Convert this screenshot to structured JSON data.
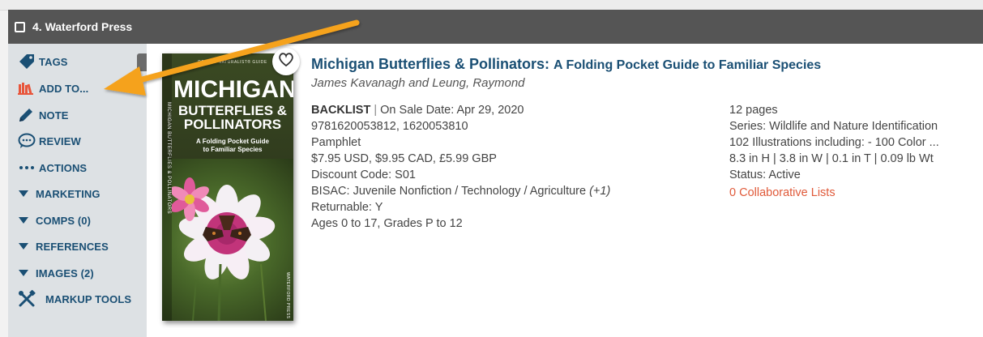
{
  "header": {
    "title": "4. Waterford Press"
  },
  "sidebar": {
    "items": [
      {
        "label": "TAGS",
        "icon": "tag-icon"
      },
      {
        "label": "ADD TO...",
        "icon": "books-icon"
      },
      {
        "label": "NOTE",
        "icon": "pencil-icon"
      },
      {
        "label": "REVIEW",
        "icon": "speech-bubble-icon"
      },
      {
        "label": "ACTIONS",
        "icon": "dots-icon"
      },
      {
        "label": "MARKETING",
        "icon": "caret-down-icon"
      },
      {
        "label": "COMPS (0)",
        "icon": "caret-down-icon"
      },
      {
        "label": "REFERENCES",
        "icon": "caret-down-icon"
      },
      {
        "label": "IMAGES (2)",
        "icon": "caret-down-icon"
      },
      {
        "label": "MARKUP TOOLS",
        "icon": "tools-icon"
      }
    ]
  },
  "cover": {
    "series": "POCKET NATURALIST® GUIDE",
    "title_line1": "MICHIGAN",
    "title_line2": "BUTTERFLIES &",
    "title_line3": "POLLINATORS",
    "subtitle_line1": "A Folding Pocket Guide",
    "subtitle_line2": "to Familiar Species",
    "side_title": "MICHIGAN BUTTERFLIES & POLLINATORS",
    "side_subtitle": "to Familiar Species",
    "publisher": "WATERFORD PRESS"
  },
  "book": {
    "title": "Michigan Butterflies & Pollinators:",
    "subtitle": "A Folding Pocket Guide to Familiar Species",
    "authors": "James Kavanagh and Leung, Raymond",
    "status_label": "BACKLIST",
    "separator": "|",
    "on_sale": "On Sale Date: Apr 29, 2020",
    "isbns": "9781620053812, 1620053810",
    "format": "Pamphlet",
    "prices": "$7.95 USD, $9.95 CAD, £5.99 GBP",
    "discount": "Discount Code: S01",
    "bisac": "BISAC: Juvenile Nonfiction / Technology / Agriculture",
    "bisac_more": "(+1)",
    "returnable": "Returnable: Y",
    "ages": "Ages 0 to 17, Grades P to 12",
    "pages": "12 pages",
    "series": "Series: Wildlife and Nature Identification",
    "illustrations": "102 Illustrations including: - 100 Color ...",
    "dimensions": "8.3 in H | 3.8 in W | 0.1 in T | 0.09 lb Wt",
    "status": "Status: Active",
    "collab_lists": "0 Collaborative Lists"
  },
  "colors": {
    "accent_blue": "#1a4f74",
    "header_bg": "#555555",
    "sidebar_bg": "#dde1e4",
    "arrow": "#f5a21b",
    "link_red": "#e05a3a",
    "books_icon": "#e8553b"
  }
}
